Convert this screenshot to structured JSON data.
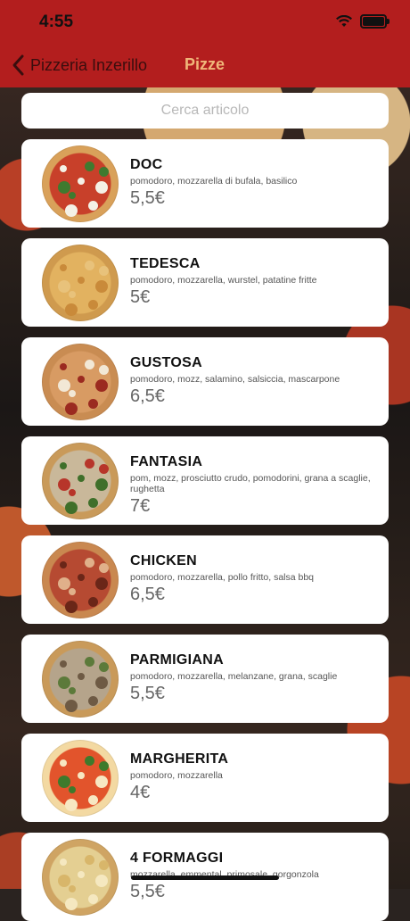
{
  "status": {
    "time": "4:55"
  },
  "nav": {
    "back_label": "Pizzeria Inzerillo",
    "title": "Pizze"
  },
  "search": {
    "placeholder": "Cerca articolo"
  },
  "colors": {
    "bar": "#b31e1e",
    "title": "#f0b77a"
  },
  "items": [
    {
      "name": "DOC",
      "desc": "pomodoro, mozzarella di bufala, basilico",
      "price": "5,5€",
      "pizza": {
        "base": "#c8402a",
        "crust": "#d9a15a",
        "toppings": [
          "#f4f1e6",
          "#3f7a2f"
        ]
      }
    },
    {
      "name": "TEDESCA",
      "desc": "pomodoro, mozzarella, wurstel, patatine fritte",
      "price": "5€",
      "pizza": {
        "base": "#e2b260",
        "crust": "#cf9a4e",
        "toppings": [
          "#c98a3a",
          "#e8c27b"
        ]
      }
    },
    {
      "name": "GUSTOSA",
      "desc": "pomodoro, mozz, salamino, salsiccia, mascarpone",
      "price": "6,5€",
      "pizza": {
        "base": "#d89b63",
        "crust": "#c98c52",
        "toppings": [
          "#9b2a20",
          "#f2e8d6"
        ]
      }
    },
    {
      "name": "FANTASIA",
      "desc": "pom, mozz, prosciutto crudo, pomodorini, grana a scaglie, rughetta",
      "price": "7€",
      "pizza": {
        "base": "#c9b89a",
        "crust": "#c99a5a",
        "toppings": [
          "#3f6f2a",
          "#b7352a"
        ]
      }
    },
    {
      "name": "CHICKEN",
      "desc": "pomodoro, mozzarella, pollo fritto, salsa bbq",
      "price": "6,5€",
      "pizza": {
        "base": "#b64a32",
        "crust": "#c98850",
        "toppings": [
          "#6a2618",
          "#e0b08a"
        ]
      }
    },
    {
      "name": "PARMIGIANA",
      "desc": "pomodoro, mozzarella, melanzane, grana, scaglie",
      "price": "5,5€",
      "pizza": {
        "base": "#b5a48b",
        "crust": "#c99a5a",
        "toppings": [
          "#6e5a44",
          "#5c7a3a"
        ]
      }
    },
    {
      "name": "MARGHERITA",
      "desc": "pomodoro, mozzarella",
      "price": "4€",
      "pizza": {
        "base": "#e2542c",
        "crust": "#f3d9a2",
        "toppings": [
          "#f7e7c2",
          "#3d7a2c"
        ]
      }
    },
    {
      "name": "4 FORMAGGI",
      "desc": "mozzarella, emmental, primosale, gorgonzola",
      "price": "5,5€",
      "pizza": {
        "base": "#e4cf92",
        "crust": "#cfa463",
        "toppings": [
          "#f5e8c0",
          "#d8b66a"
        ]
      }
    }
  ]
}
